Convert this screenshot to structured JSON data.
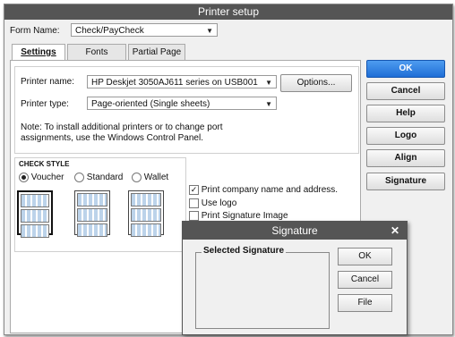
{
  "window": {
    "title": "Printer setup"
  },
  "form_name": {
    "label": "Form Name:",
    "value": "Check/PayCheck"
  },
  "tabs": [
    {
      "label": "Settings"
    },
    {
      "label": "Fonts"
    },
    {
      "label": "Partial Page"
    }
  ],
  "printer_name": {
    "label": "Printer name:",
    "value": "HP Deskjet 3050AJ611 series on USB001"
  },
  "printer_type": {
    "label": "Printer type:",
    "value": "Page-oriented (Single sheets)"
  },
  "options_button": "Options...",
  "note": {
    "line1": "Note: To install additional printers or to change port",
    "line2": "assignments, use the Windows Control Panel."
  },
  "check_style": {
    "title": "CHECK STYLE",
    "options": [
      {
        "label": "Voucher",
        "selected": true
      },
      {
        "label": "Standard",
        "selected": false
      },
      {
        "label": "Wallet",
        "selected": false
      }
    ]
  },
  "checkboxes": [
    {
      "label": "Print company name and address.",
      "checked": true
    },
    {
      "label": "Use logo",
      "checked": false
    },
    {
      "label": "Print Signature Image",
      "checked": false
    }
  ],
  "side_buttons": {
    "ok": "OK",
    "cancel": "Cancel",
    "help": "Help",
    "logo": "Logo",
    "align": "Align",
    "signature": "Signature"
  },
  "signature_dialog": {
    "title": "Signature",
    "group": "Selected Signature",
    "ok": "OK",
    "cancel": "Cancel",
    "file": "File"
  }
}
